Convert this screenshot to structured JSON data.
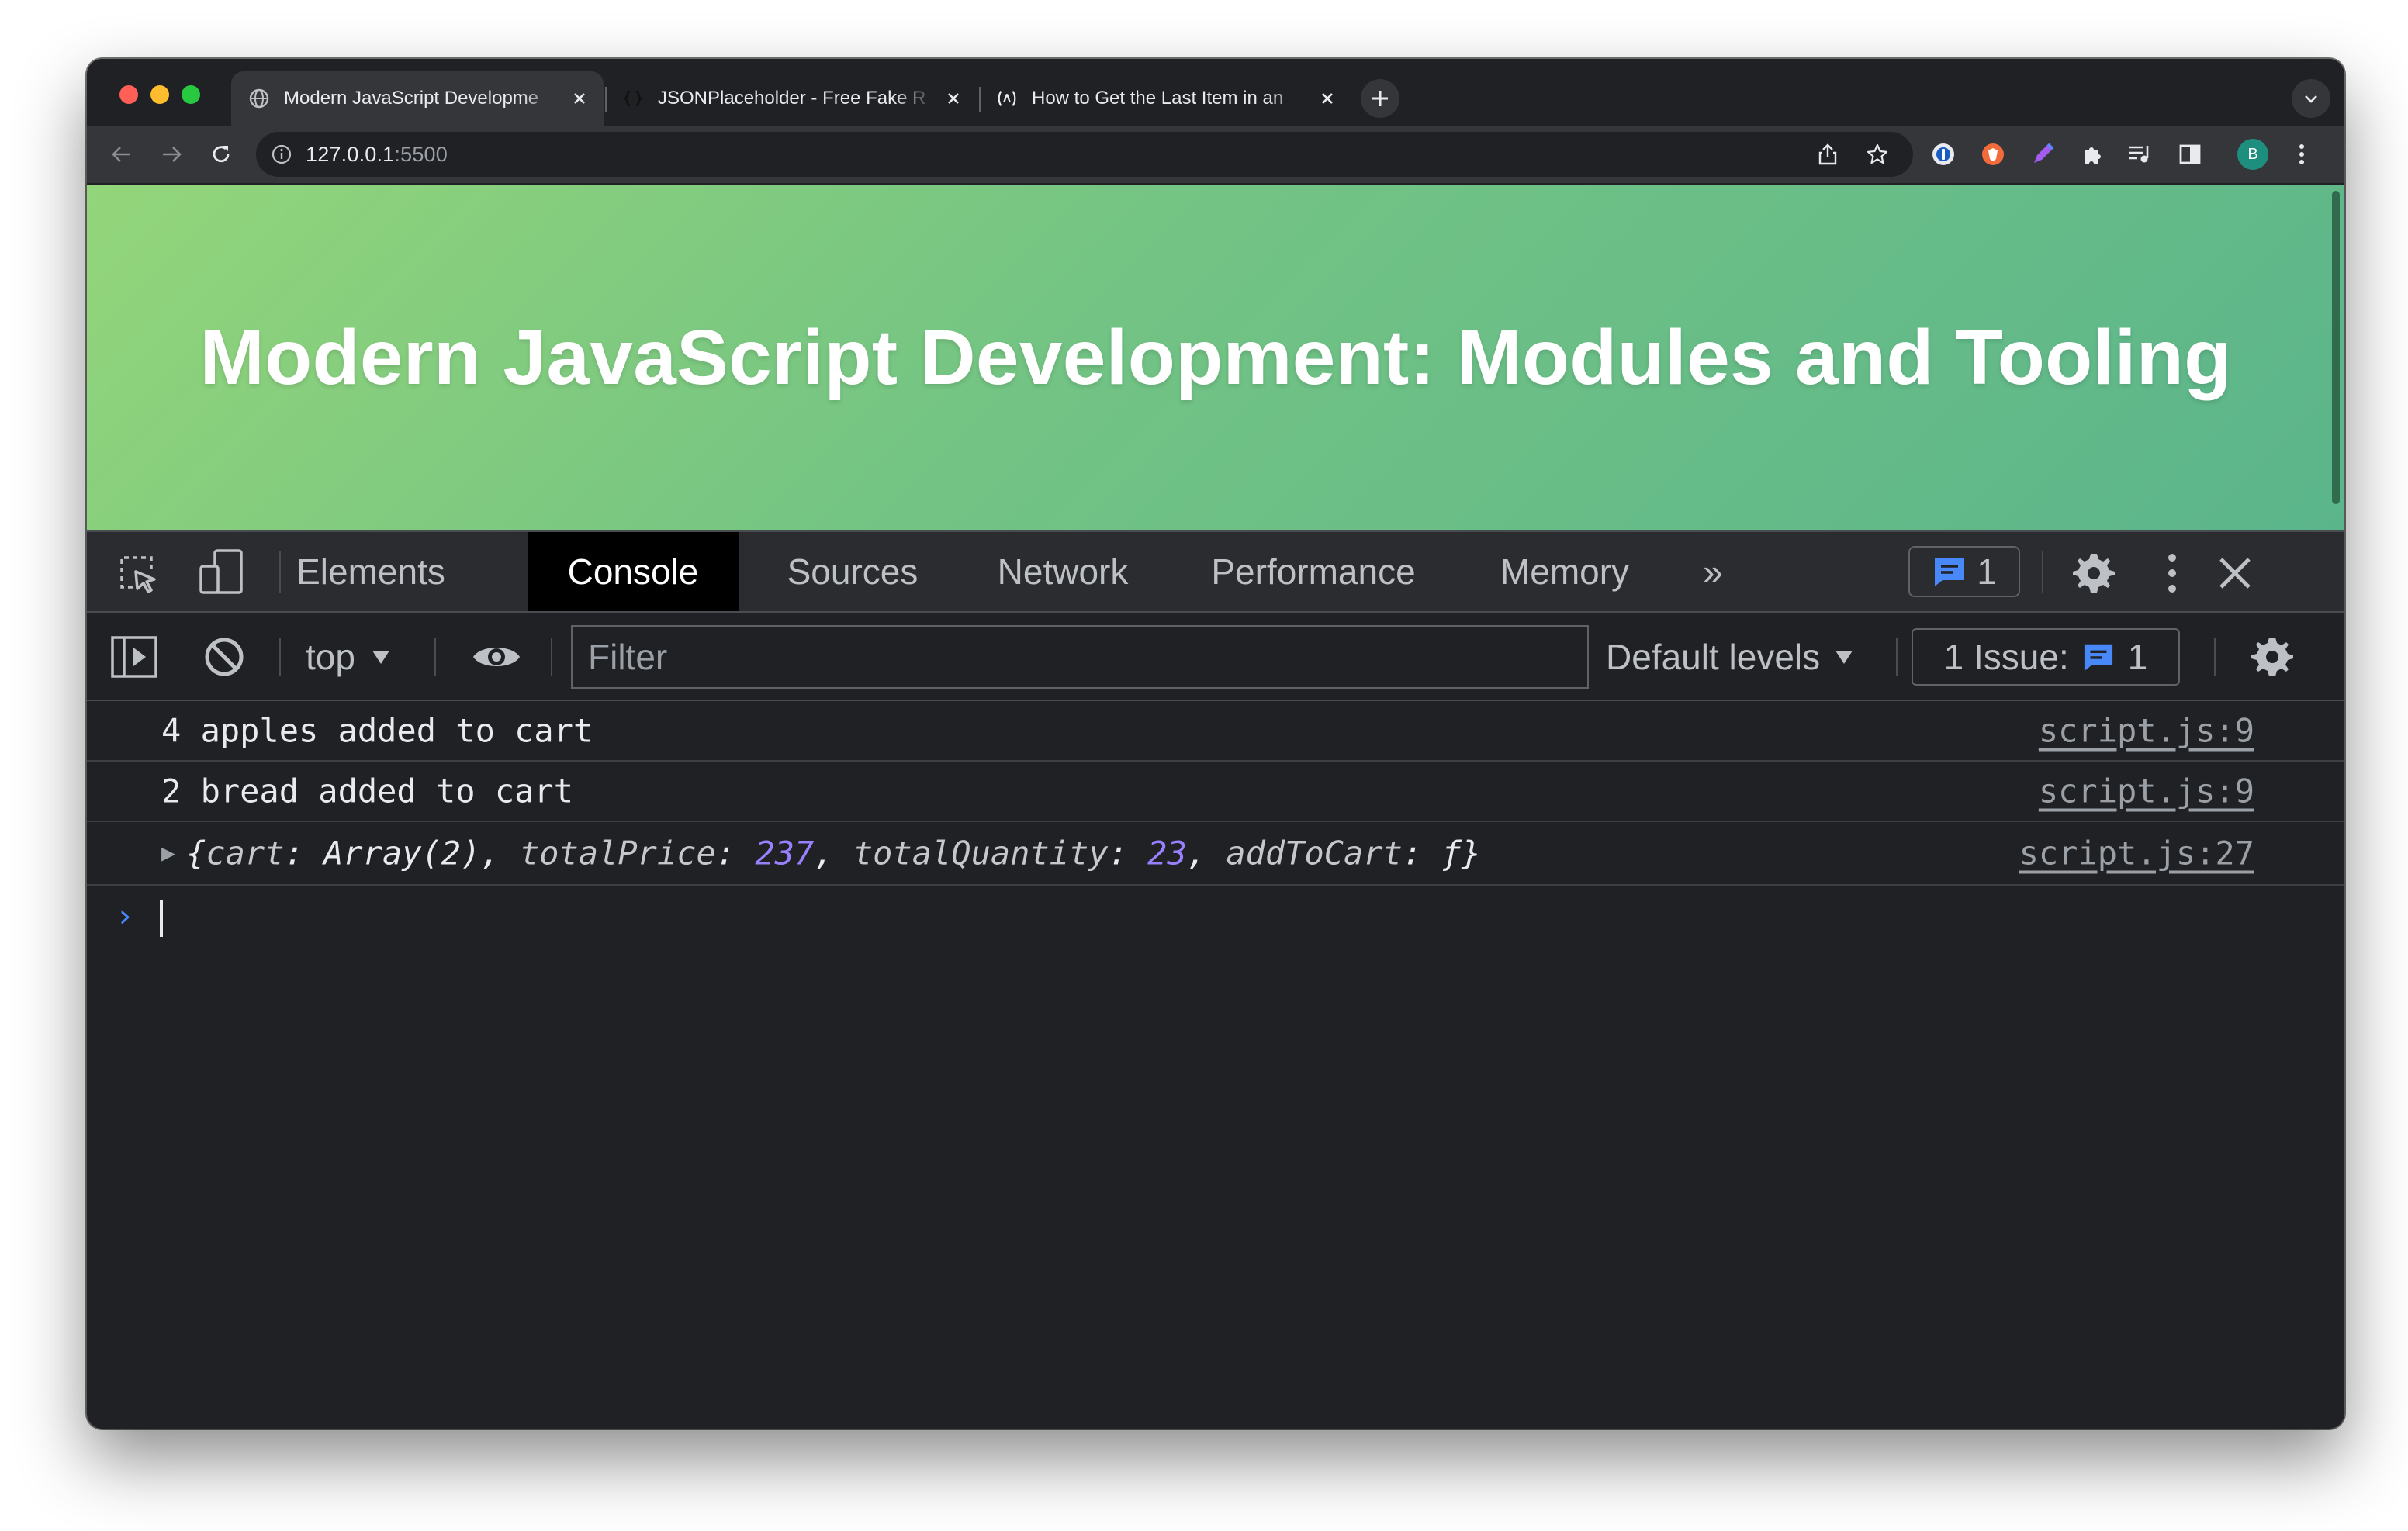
{
  "browser": {
    "tabs": [
      {
        "title": "Modern JavaScript Developme",
        "favicon": "globe-icon",
        "active": true
      },
      {
        "title": "JSONPlaceholder - Free Fake R",
        "favicon": "jsonplaceholder-icon",
        "active": false
      },
      {
        "title": "How to Get the Last Item in an",
        "favicon": "freecodecamp-icon",
        "active": false
      }
    ],
    "url_host": "127.0.0.1",
    "url_port": ":5500",
    "profile_initial": "B",
    "extensions": [
      "1password-icon",
      "brave-lion-icon",
      "pen-icon",
      "puzzle-icon",
      "media-control-icon",
      "sidepanel-icon"
    ]
  },
  "page": {
    "heading": "Modern JavaScript Development: Modules and Tooling",
    "gradient_colors": [
      "#93d57a",
      "#5bb58b"
    ]
  },
  "devtools": {
    "tabs": [
      "Elements",
      "Console",
      "Sources",
      "Network",
      "Performance",
      "Memory"
    ],
    "active_tab": "Console",
    "more_tabs_glyph": "»",
    "messages_badge_count": "1",
    "console_bar": {
      "context": "top",
      "filter_placeholder": "Filter",
      "levels": "Default levels",
      "issues_label": "1 Issue:",
      "issues_count": "1"
    },
    "messages": [
      {
        "text": "4 apples added to cart",
        "source": "script.js:9"
      },
      {
        "text": "2 bread added to cart",
        "source": "script.js:9"
      },
      {
        "source": "script.js:27",
        "object": {
          "open": "{",
          "k1": "cart",
          "v1": "Array(2)",
          "k2": "totalPrice",
          "v2": "237",
          "k3": "totalQuantity",
          "v3": "23",
          "k4": "addToCart",
          "v4": "ƒ",
          "close": "}"
        }
      }
    ],
    "prompt_glyph": "›"
  }
}
